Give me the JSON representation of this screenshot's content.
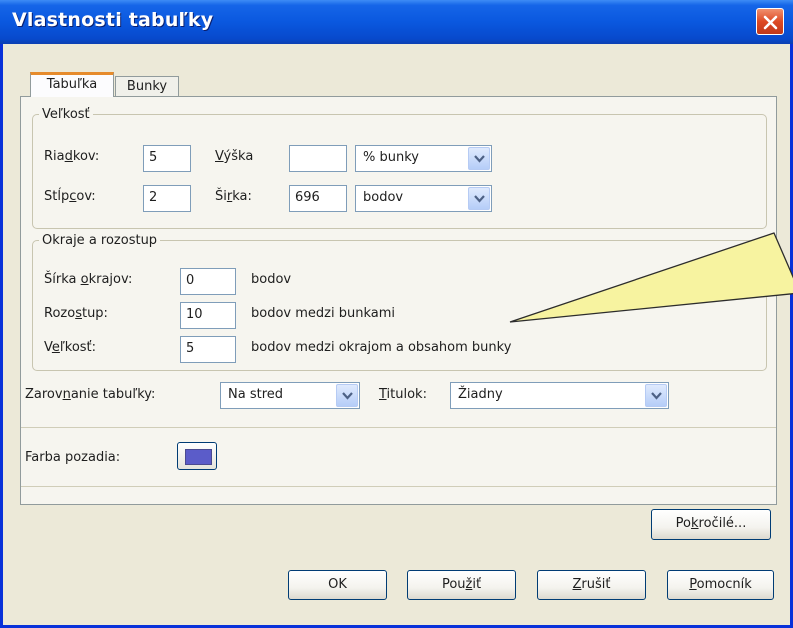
{
  "window": {
    "title": "Vlastnosti tabuľky"
  },
  "tabs": [
    {
      "label": "Tabuľka",
      "active": true
    },
    {
      "label": "Bunky",
      "active": false
    }
  ],
  "size_group": {
    "legend": "Veľkosť",
    "rows_label_pre": "Ria",
    "rows_label_u": "d",
    "rows_label_post": "kov:",
    "rows_value": "5",
    "height_label_u": "V",
    "height_label_post": "ýška",
    "height_value": "",
    "height_unit": "% bunky",
    "cols_label_pre": "Stĺp",
    "cols_label_u": "c",
    "cols_label_post": "ov:",
    "cols_value": "2",
    "width_label_pre": "Ši",
    "width_label_u": "r",
    "width_label_post": "ka:",
    "width_value": "696",
    "width_unit": "bodov"
  },
  "borders_group": {
    "legend": "Okraje a rozostup",
    "border_label_pre": "Šírka ",
    "border_label_u": "o",
    "border_label_post": "krajov:",
    "border_value": "0",
    "border_unit": "bodov",
    "spacing_label_pre": "Rozo",
    "spacing_label_u": "s",
    "spacing_label_post": "tup:",
    "spacing_value": "10",
    "spacing_unit": "bodov medzi bunkami",
    "padding_label_pre": "V",
    "padding_label_u": "e",
    "padding_label_post": "ľkosť:",
    "padding_value": "5",
    "padding_unit": "bodov medzi okrajom a obsahom bunky"
  },
  "alignment": {
    "label_pre": "Zarov",
    "label_u": "n",
    "label_post": "anie tabuľky:",
    "value": "Na stred"
  },
  "caption": {
    "label_u": "T",
    "label_post": "itulok:",
    "value": "Žiadny"
  },
  "background": {
    "label": "Farba pozadia:",
    "color": "#5b5cc9"
  },
  "advanced_button": {
    "pre": "Po",
    "u": "k",
    "post": "ročilé..."
  },
  "buttons": {
    "ok": "OK",
    "apply_pre": "Pou",
    "apply_u": "ž",
    "apply_post": "iť",
    "cancel_u": "Z",
    "cancel_post": "rušiť",
    "help_u": "P",
    "help_post": "omocník"
  },
  "colors": {
    "title_bar": "#0a58df",
    "dialog_bg": "#ece9d8",
    "callout_fill": "#f7f3a0",
    "close_button": "#dd4a24"
  }
}
